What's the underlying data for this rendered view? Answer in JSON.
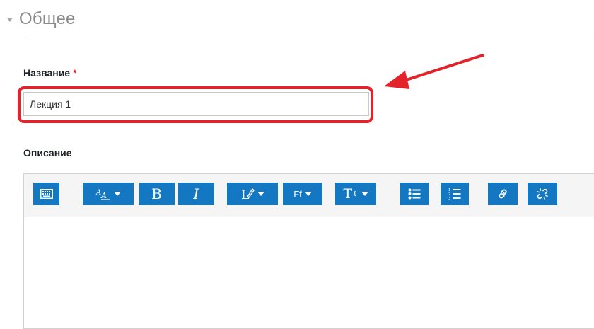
{
  "section": {
    "title": "Общее"
  },
  "name_field": {
    "label": "Название",
    "required_mark": "*",
    "value": "Лекция 1"
  },
  "description_field": {
    "label": "Описание"
  },
  "toolbar": {
    "buttons": [
      {
        "name": "toggle-toolbar-button",
        "icon": "keyboard-icon"
      },
      {
        "name": "font-style-button",
        "icon": "text-style-icon",
        "dropdown": true
      },
      {
        "name": "bold-button",
        "icon": "bold-icon",
        "glyph": "B"
      },
      {
        "name": "italic-button",
        "icon": "italic-icon",
        "glyph": "I"
      },
      {
        "name": "text-color-button",
        "icon": "brush-icon",
        "dropdown": true
      },
      {
        "name": "font-family-button",
        "icon": "font-family-icon",
        "glyph": "Ff",
        "dropdown": true
      },
      {
        "name": "font-size-button",
        "icon": "font-size-icon",
        "glyph": "T",
        "dropdown": true
      },
      {
        "name": "bullet-list-button",
        "icon": "bullet-list-icon"
      },
      {
        "name": "numbered-list-button",
        "icon": "numbered-list-icon"
      },
      {
        "name": "link-button",
        "icon": "link-icon"
      },
      {
        "name": "unlink-button",
        "icon": "unlink-icon"
      }
    ]
  },
  "colors": {
    "button_blue": "#1477c1",
    "highlight_red": "#e2232b",
    "required_red": "#e41f28"
  }
}
